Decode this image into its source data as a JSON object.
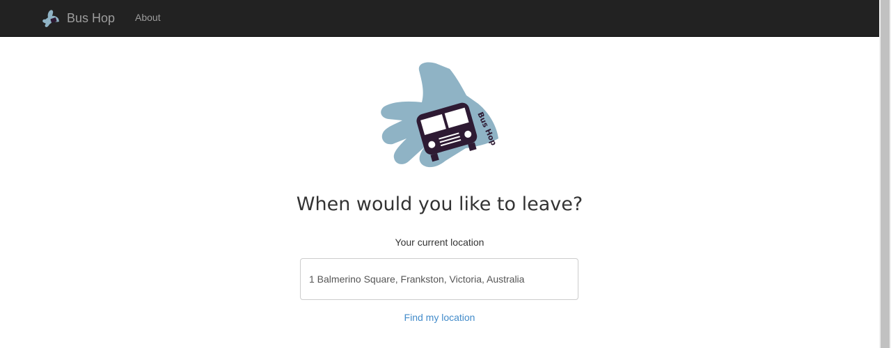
{
  "navbar": {
    "brand": "Bus Hop",
    "about": "About"
  },
  "logo": {
    "text": "Bus Hop"
  },
  "main": {
    "heading": "When would you like to leave?",
    "location_label": "Your current location",
    "location_value": "1 Balmerino Square, Frankston, Victoria, Australia",
    "find_location": "Find my location"
  },
  "colors": {
    "navbar_bg": "#222222",
    "hand": "#8fb3c5",
    "bus": "#2e1a33",
    "link": "#428bca"
  },
  "icons": {
    "brand": "hand-bus-icon",
    "logo": "hand-bus-logo"
  }
}
